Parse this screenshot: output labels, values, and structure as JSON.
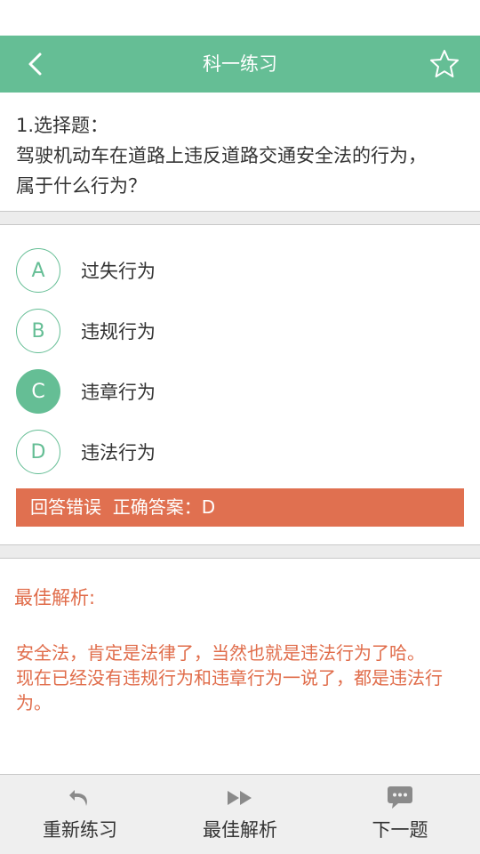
{
  "header": {
    "title": "科一练习",
    "back_icon": "chevron-left-icon",
    "favorite_icon": "star-outline-icon"
  },
  "question": {
    "type_line": "1.选择题：",
    "text": "驾驶机动车在道路上违反道路交通安全法的行为，属于什么行为？"
  },
  "options": [
    {
      "letter": "A",
      "text": "过失行为",
      "selected": false
    },
    {
      "letter": "B",
      "text": "违规行为",
      "selected": false
    },
    {
      "letter": "C",
      "text": "违章行为",
      "selected": true
    },
    {
      "letter": "D",
      "text": "违法行为",
      "selected": false
    }
  ],
  "result": {
    "text": "回答错误  正确答案：D"
  },
  "analysis": {
    "title": "最佳解析:",
    "line1": "安全法，肯定是法律了，当然也就是违法行为了哈。",
    "line2": "现在已经没有违规行为和违章行为一说了，都是违法行为。"
  },
  "bottom_nav": [
    {
      "label": "重新练习",
      "icon": "undo-arrow-icon"
    },
    {
      "label": "最佳解析",
      "icon": "fast-forward-icon"
    },
    {
      "label": "下一题",
      "icon": "chat-bubble-icon"
    }
  ],
  "colors": {
    "primary": "#65be95",
    "error": "#e07050",
    "analysis_text": "#e06c4a"
  }
}
